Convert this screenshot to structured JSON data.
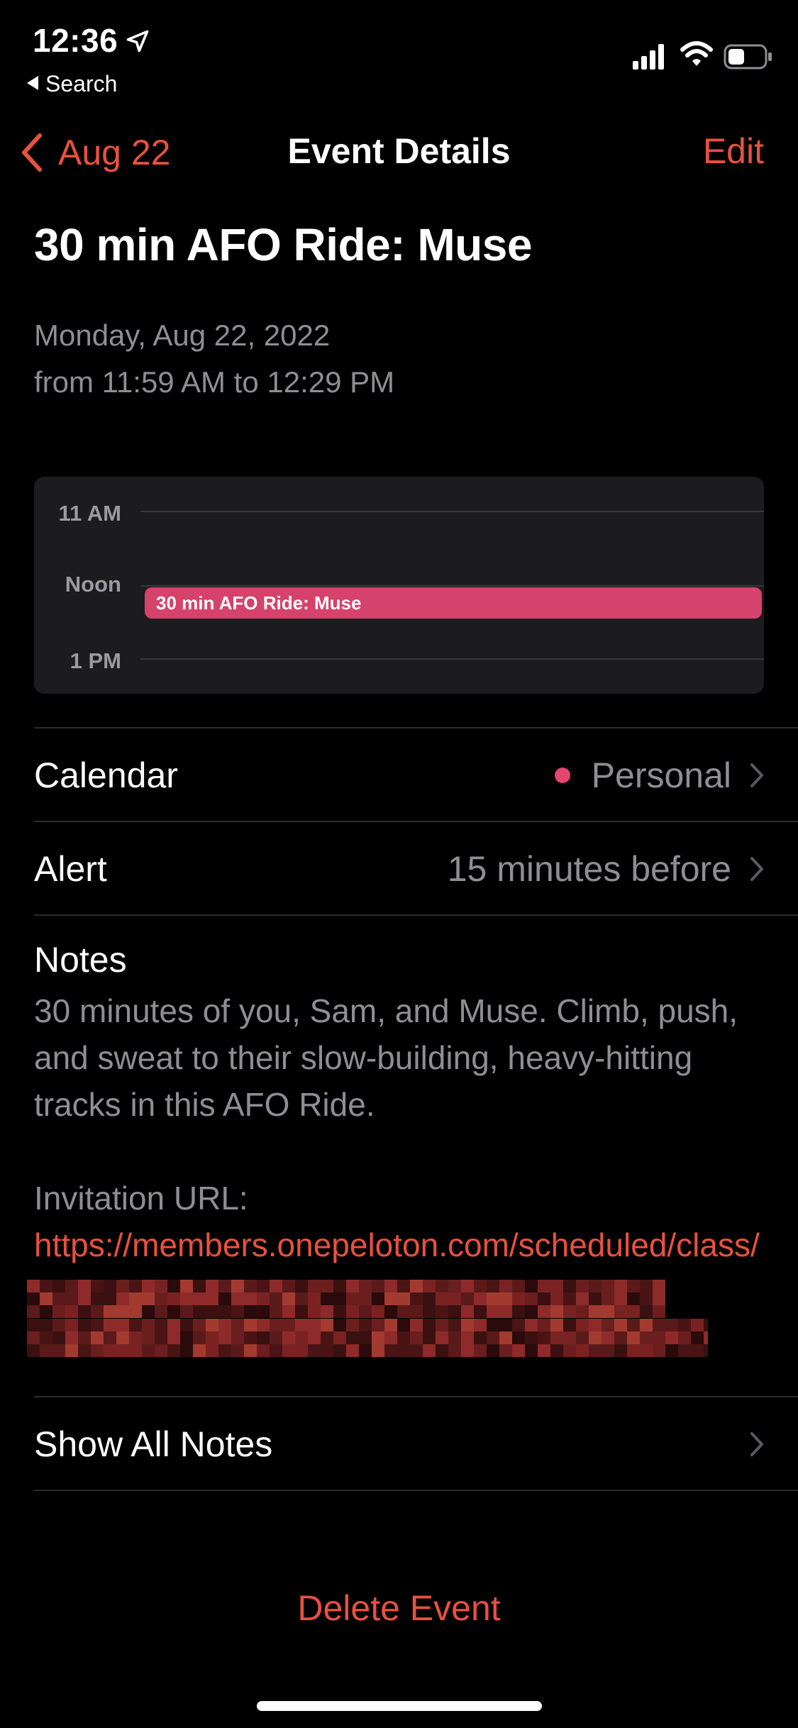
{
  "status_bar": {
    "time": "12:36",
    "back_app": "Search"
  },
  "nav": {
    "back_label": "Aug 22",
    "title": "Event Details",
    "edit_label": "Edit"
  },
  "event": {
    "title": "30 min AFO Ride: Muse",
    "date_line": "Monday, Aug 22, 2022",
    "time_line": "from 11:59 AM to 12:29 PM"
  },
  "day_preview": {
    "hours": [
      "11 AM",
      "Noon",
      "1 PM"
    ],
    "event_label": "30 min AFO Ride: Muse",
    "event_color": "#d5426b"
  },
  "calendar_row": {
    "label": "Calendar",
    "value": "Personal",
    "dot_color": "#e6456f"
  },
  "alert_row": {
    "label": "Alert",
    "value": "15 minutes before"
  },
  "notes": {
    "label": "Notes",
    "body": "30 minutes of you, Sam, and Muse. Climb, push, and sweat to their slow-building, heavy-hitting tracks in this AFO Ride.",
    "invite_prefix": "Invitation URL: ",
    "invite_url": "https://members.onepeloton.com/scheduled/class/"
  },
  "show_all_notes": "Show All Notes",
  "delete_label": "Delete Event",
  "accent_color": "#e8513f"
}
